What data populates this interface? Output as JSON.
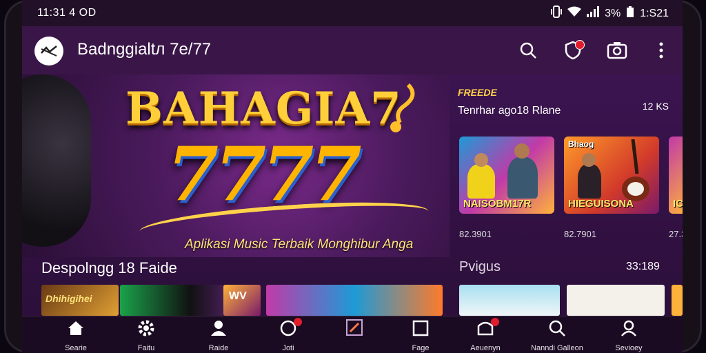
{
  "status": {
    "time": "11:31 4 OD",
    "battery": "3%",
    "clock": "1:S21"
  },
  "app": {
    "title": "Badnggialtл 7e/77"
  },
  "hero": {
    "title": "BAHAGIA7",
    "number": "7777",
    "subtitle": "Aplikasi Music Terbaik Monghibur Anga"
  },
  "side": {
    "label": "FREEDE",
    "title": "Tenrhar ago18 Rlane",
    "count": "12 KS",
    "cards": [
      {
        "caption": "NAISOBM17R",
        "stat": "82.3901",
        "label": ""
      },
      {
        "caption": "HIEGUISONA",
        "stat": "82.7901",
        "label": "Bhaog"
      },
      {
        "caption": "IC",
        "stat": "27.3",
        "label": ""
      }
    ]
  },
  "sections": {
    "left_title": "Despolngg 18 Faide",
    "right_title": "Pvigus",
    "right_count": "33:189"
  },
  "thumbs": [
    {
      "text": "Dhihigihei"
    },
    {
      "text": ""
    },
    {
      "text": "WV"
    },
    {
      "text": ""
    },
    {
      "text": ""
    }
  ],
  "nav": [
    {
      "label": "Searie",
      "icon": "home-icon"
    },
    {
      "label": "Faitu",
      "icon": "settings-icon"
    },
    {
      "label": "Raide",
      "icon": "profile-icon"
    },
    {
      "label": "Joti",
      "icon": "activity-icon"
    },
    {
      "label": "",
      "icon": "music-note-icon"
    },
    {
      "label": "Fage",
      "icon": "library-icon"
    },
    {
      "label": "Aeuenyn",
      "icon": "notifications-icon"
    },
    {
      "label": "Nanndi Galleon",
      "icon": "search-icon"
    },
    {
      "label": "Sevioey",
      "icon": "account-icon"
    }
  ],
  "colors": {
    "accent": "#ffb400",
    "background": "#2a1036",
    "badge": "#e11d2c"
  }
}
